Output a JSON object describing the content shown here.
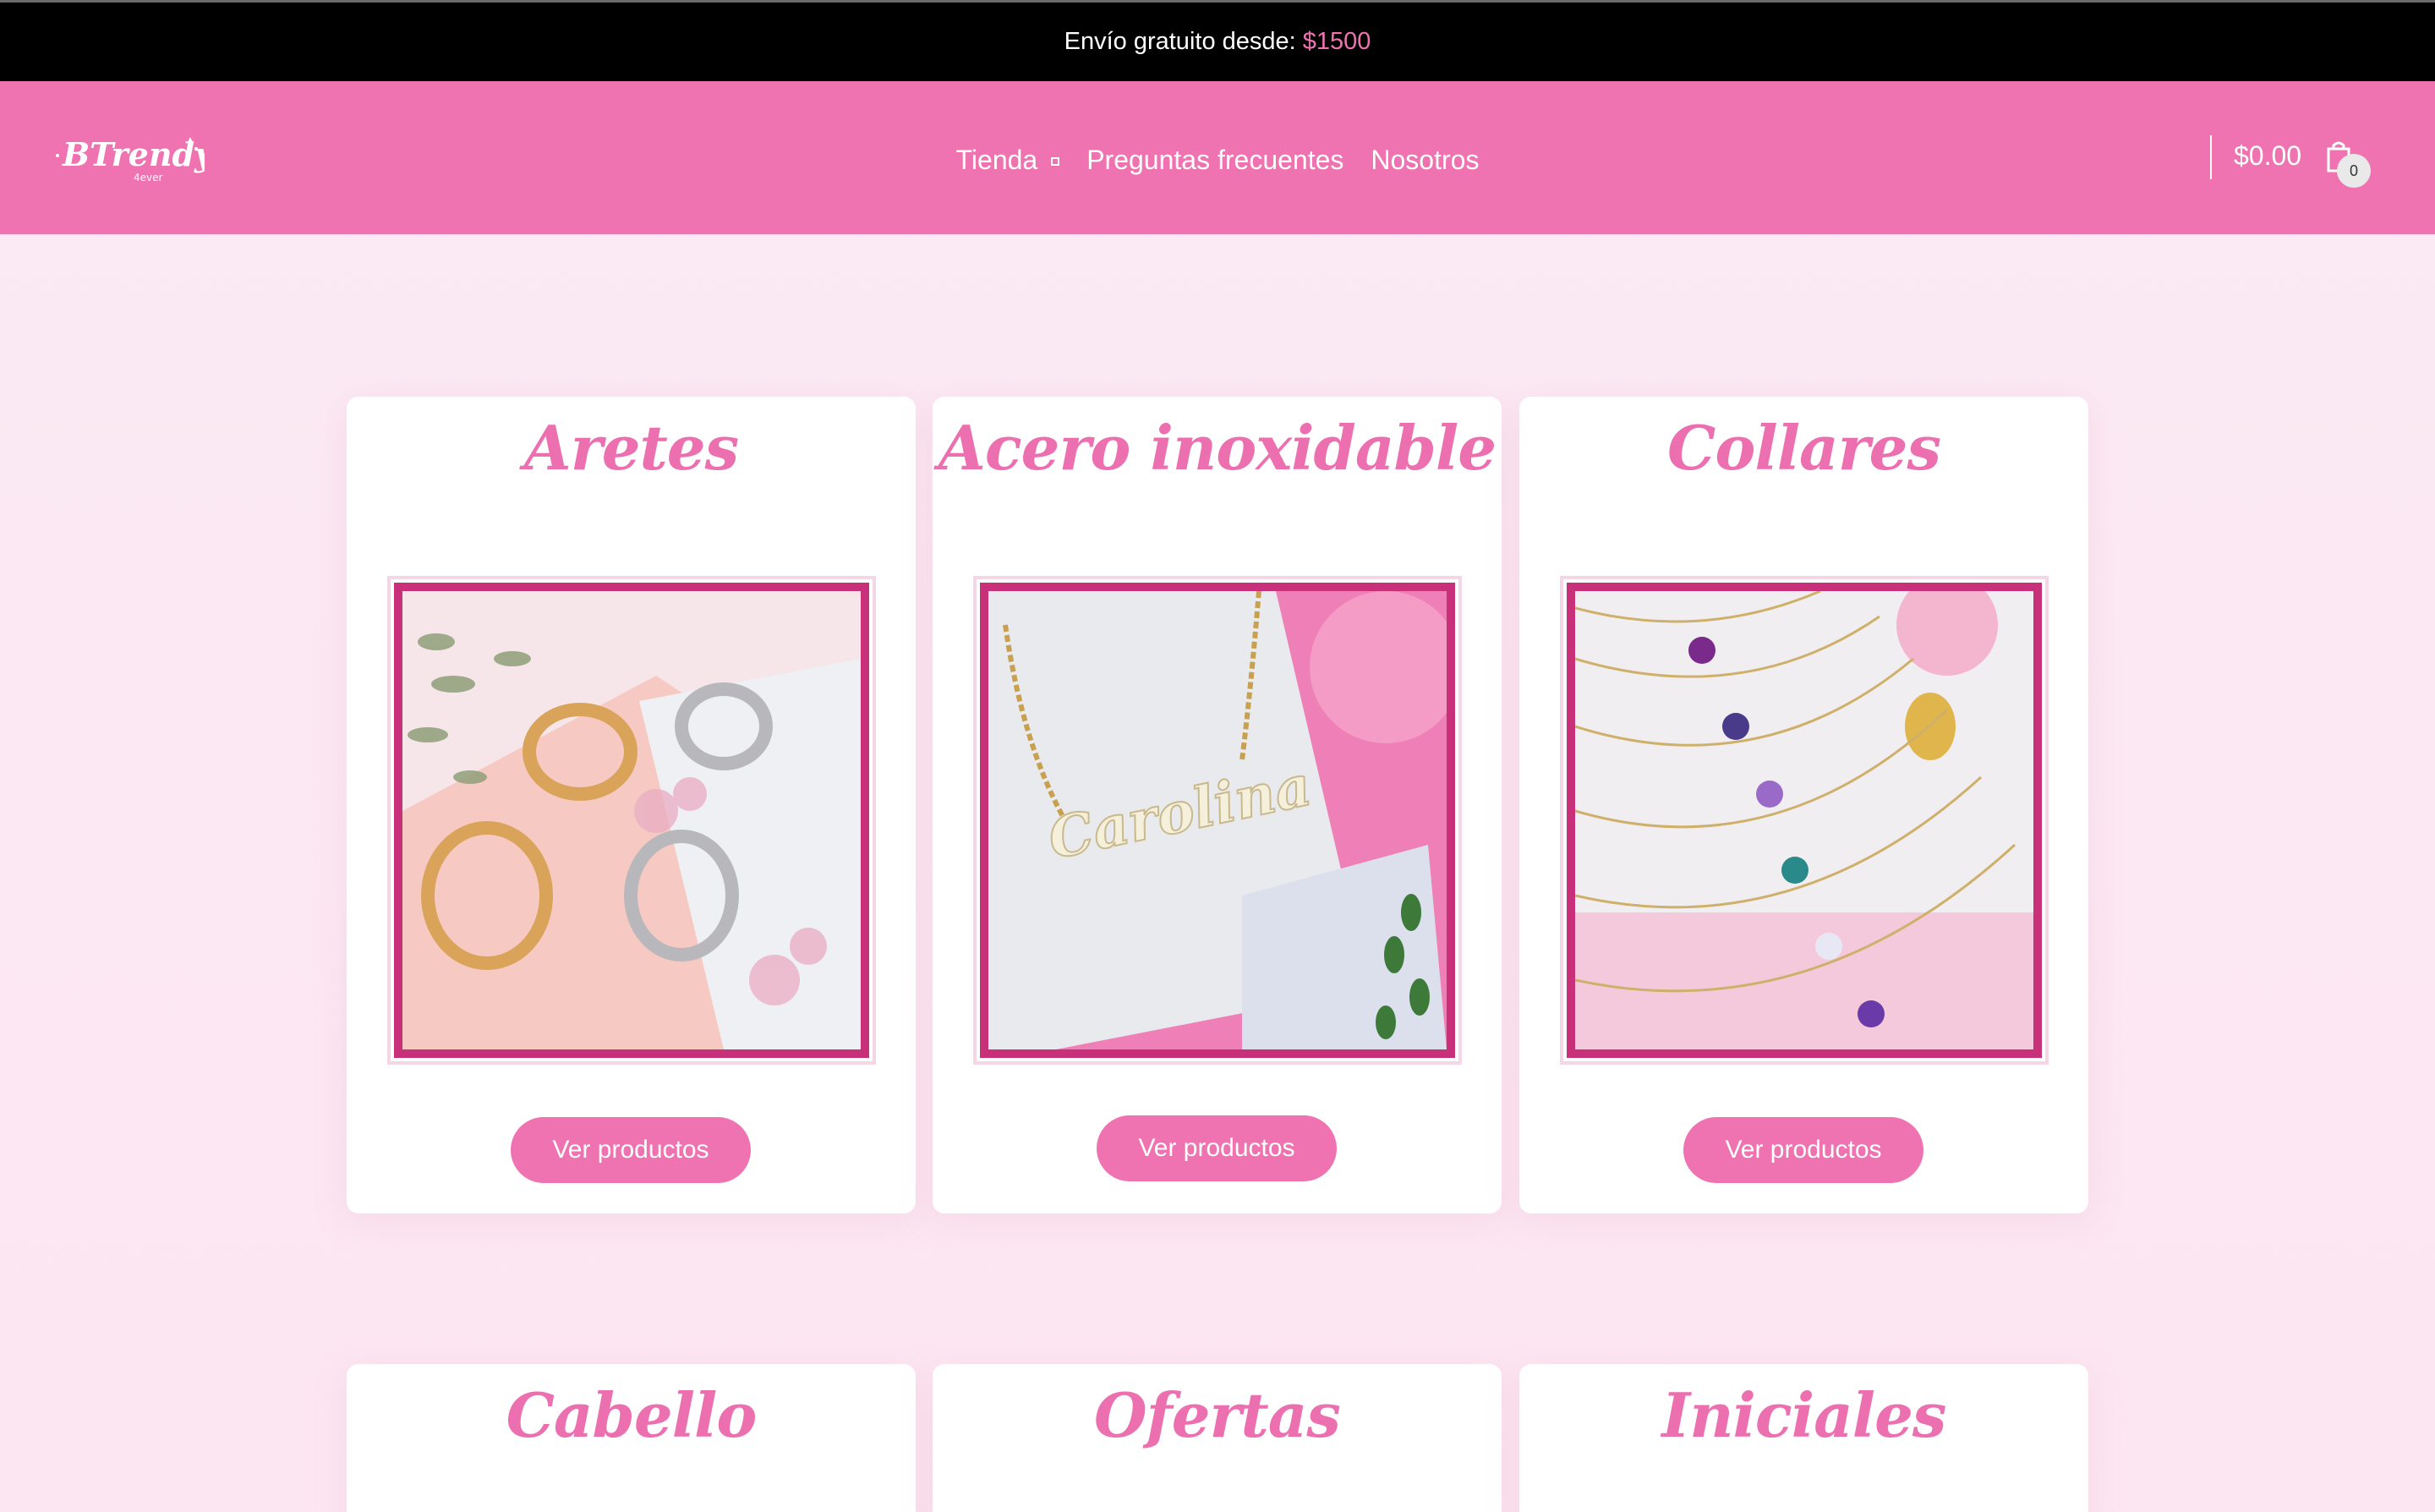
{
  "topbar": {
    "prefix": "Envío gratuito desde:",
    "amount": "$1500"
  },
  "header": {
    "nav": [
      {
        "label": "Tienda",
        "dropdown": true
      },
      {
        "label": "Preguntas frecuentes"
      },
      {
        "label": "Nosotros"
      }
    ],
    "cart_total": "$0.00",
    "cart_count": "0"
  },
  "categories": [
    {
      "title": "Aretes",
      "button": "Ver productos",
      "image": "earrings-photo"
    },
    {
      "title": "Acero inoxidable",
      "button": "Ver productos",
      "image": "name-necklace-photo",
      "necklace_text": "Carolina"
    },
    {
      "title": "Collares",
      "button": "Ver productos",
      "image": "butterfly-necklaces-photo"
    },
    {
      "title": "Cabello"
    },
    {
      "title": "Ofertas"
    },
    {
      "title": "Iniciales"
    }
  ],
  "colors": {
    "accent": "#ef73b1",
    "frame": "#c8317a",
    "topbar": "#000000"
  }
}
